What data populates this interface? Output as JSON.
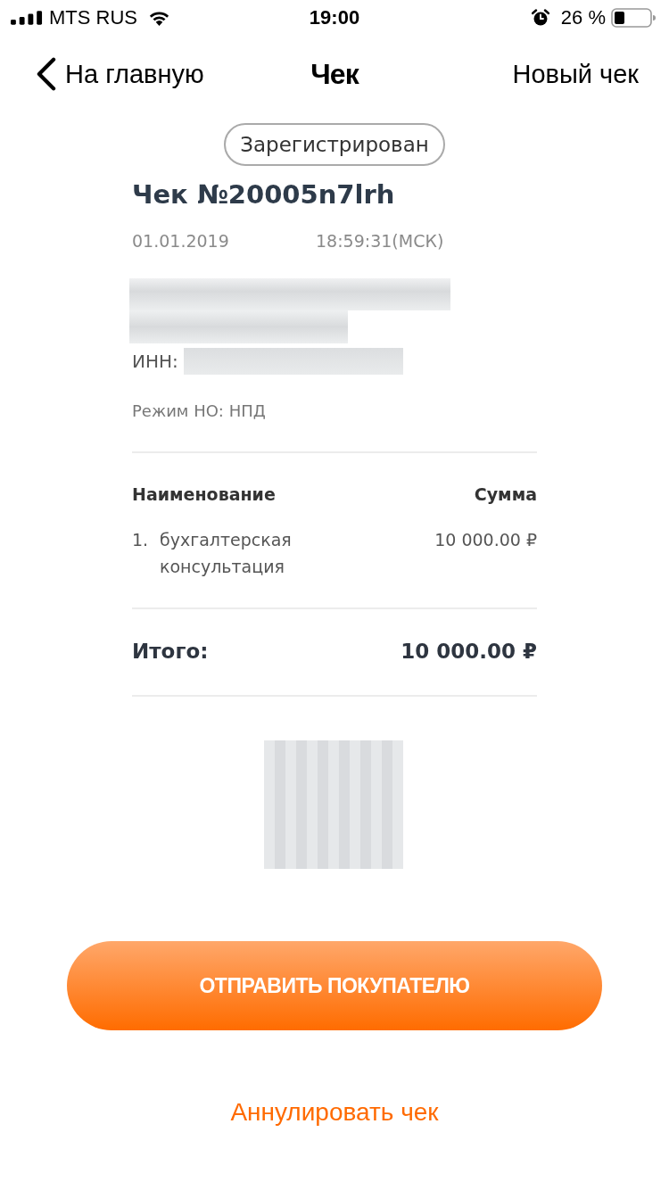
{
  "status_bar": {
    "carrier": "MTS RUS",
    "time": "19:00",
    "battery": "26 %"
  },
  "nav": {
    "back": "На главную",
    "title": "Чек",
    "action": "Новый чек"
  },
  "receipt": {
    "status": "Зарегистрирован",
    "title": "Чек №20005n7lrh",
    "date": "01.01.2019",
    "time": "18:59:31(МСК)",
    "inn_label": "ИНН:",
    "tax_mode": "Режим НО: НПД",
    "columns": [
      "Наименование",
      "Сумма"
    ],
    "items": [
      {
        "number": "1.",
        "name": "бухгалтерская консультация",
        "amount": "10 000.00 ₽"
      }
    ],
    "total_label": "Итого:",
    "total": "10 000.00 ₽"
  },
  "actions": {
    "primary": "ОТПРАВИТЬ ПОКУПАТЕЛЮ",
    "cancel": "Аннулировать чек"
  }
}
